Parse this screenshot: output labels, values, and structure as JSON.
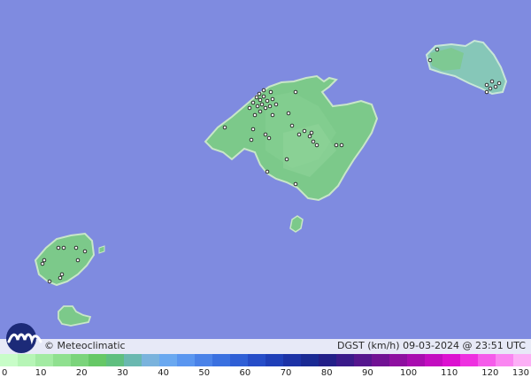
{
  "footer": {
    "brand": "© Meteoclimatic",
    "product": "DGST (km/h)   09-03-2024 @ 23:51 UTC"
  },
  "legend": {
    "ticks": [
      "0",
      "10",
      "20",
      "30",
      "40",
      "50",
      "60",
      "70",
      "80",
      "90",
      "100",
      "110",
      "120",
      "130"
    ],
    "colors": [
      "#c8fdc8",
      "#b6f5b6",
      "#a3eba3",
      "#8fe08f",
      "#7bd47b",
      "#66c866",
      "#5fbf7f",
      "#6ab8b0",
      "#7ab3dd",
      "#6aa8f0",
      "#5a96f0",
      "#4a82e8",
      "#3a70e0",
      "#2f5fd6",
      "#264dc8",
      "#1f3fb8",
      "#1c32a6",
      "#1a2a94",
      "#231f88",
      "#3a1a8a",
      "#55168e",
      "#711294",
      "#8e0fa0",
      "#a80caf",
      "#c30cc0",
      "#dc10d0",
      "#ee30e0",
      "#f55cea",
      "#fa86f1",
      "#fcb0f6"
    ]
  },
  "map": {
    "sea_color": "#7f8be0",
    "land_color": "#7cc98a",
    "islands": [
      "Mallorca",
      "Menorca",
      "Ibiza",
      "Formentera",
      "Cabrera"
    ]
  }
}
